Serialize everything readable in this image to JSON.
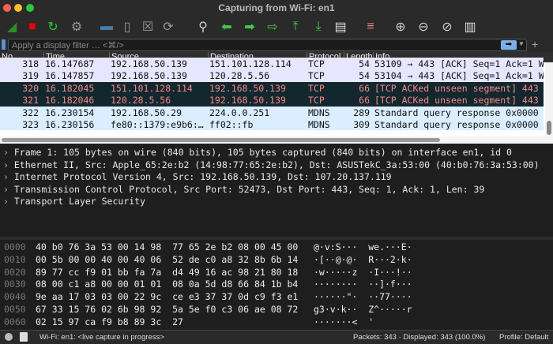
{
  "window": {
    "title": "Capturing from Wi-Fi: en1"
  },
  "toolbar": [
    "shark-fin-start-icon",
    "stop-icon",
    "restart-icon",
    "options-gear-icon",
    "open-folder-icon",
    "save-file-icon",
    "close-file-icon",
    "reload-file-icon",
    "find-icon",
    "go-back-icon",
    "go-forward-icon",
    "go-to-packet-icon",
    "first-packet-icon",
    "last-packet-icon",
    "autoscroll-icon",
    "colorize-icon",
    "zoom-in-icon",
    "zoom-out-icon",
    "zoom-reset-icon",
    "resize-columns-icon"
  ],
  "filter": {
    "placeholder": "Apply a display filter … <⌘/>"
  },
  "packet_list": {
    "columns": [
      "No.",
      "Time",
      "Source",
      "Destination",
      "Protocol",
      "Length",
      "Info"
    ],
    "rows": [
      {
        "no": "318",
        "time": "16.147687",
        "src": "192.168.50.139",
        "dst": "151.101.128.114",
        "proto": "TCP",
        "len": "54",
        "info": "53109 → 443 [ACK] Seq=1 Ack=1 W",
        "style": "tcp"
      },
      {
        "no": "319",
        "time": "16.147857",
        "src": "192.168.50.139",
        "dst": "120.28.5.56",
        "proto": "TCP",
        "len": "54",
        "info": "53104 → 443 [ACK] Seq=1 Ack=1 W",
        "style": "tcp"
      },
      {
        "no": "320",
        "time": "16.182045",
        "src": "151.101.128.114",
        "dst": "192.168.50.139",
        "proto": "TCP",
        "len": "66",
        "info": "[TCP ACKed unseen segment] 443",
        "style": "bad"
      },
      {
        "no": "321",
        "time": "16.182046",
        "src": "120.28.5.56",
        "dst": "192.168.50.139",
        "proto": "TCP",
        "len": "66",
        "info": "[TCP ACKed unseen segment] 443",
        "style": "bad"
      },
      {
        "no": "322",
        "time": "16.230154",
        "src": "192.168.50.29",
        "dst": "224.0.0.251",
        "proto": "MDNS",
        "len": "289",
        "info": "Standard query response 0x0000",
        "style": "mdns"
      },
      {
        "no": "323",
        "time": "16.230156",
        "src": "fe80::1379:e9b6:…",
        "dst": "ff02::fb",
        "proto": "MDNS",
        "len": "309",
        "info": "Standard query response 0x0000",
        "style": "mdns"
      }
    ]
  },
  "colors": {
    "tcp": "#e7e6ff",
    "bad": "#12272e",
    "bad_text": "#f78787",
    "mdns": "#daeeff"
  },
  "details": [
    "Frame 1: 105 bytes on wire (840 bits), 105 bytes captured (840 bits) on interface en1, id 0",
    "Ethernet II, Src: Apple_65:2e:b2 (14:98:77:65:2e:b2), Dst: ASUSTekC_3a:53:00 (40:b0:76:3a:53:00)",
    "Internet Protocol Version 4, Src: 192.168.50.139, Dst: 107.20.137.119",
    "Transmission Control Protocol, Src Port: 52473, Dst Port: 443, Seq: 1, Ack: 1, Len: 39",
    "Transport Layer Security"
  ],
  "hex": [
    {
      "off": "0000",
      "hex": "40 b0 76 3a 53 00 14 98  77 65 2e b2 08 00 45 00",
      "ascii": "@·v:S···  we.···E·"
    },
    {
      "off": "0010",
      "hex": "00 5b 00 00 40 00 40 06  52 de c0 a8 32 8b 6b 14",
      "ascii": "·[··@·@·  R···2·k·"
    },
    {
      "off": "0020",
      "hex": "89 77 cc f9 01 bb fa 7a  d4 49 16 ac 98 21 80 18",
      "ascii": "·w·····z  ·I···!··"
    },
    {
      "off": "0030",
      "hex": "08 00 c1 a8 00 00 01 01  08 0a 5d d8 66 84 1b b4",
      "ascii": "········  ··]·f···"
    },
    {
      "off": "0040",
      "hex": "9e aa 17 03 03 00 22 9c  ce e3 37 37 0d c9 f3 e1",
      "ascii": "······\"·  ··77····"
    },
    {
      "off": "0050",
      "hex": "67 33 15 76 02 6b 98 92  5a 5e f0 c3 06 ae 08 72",
      "ascii": "g3·v·k··  Z^·····r"
    },
    {
      "off": "0060",
      "hex": "02 15 97 ca f9 b8 89 3c  27",
      "ascii": "·······<  '"
    }
  ],
  "status": {
    "interface": "Wi-Fi: en1: <live capture in progress>",
    "packets": "Packets: 343 · Displayed: 343 (100.0%)",
    "profile": "Profile: Default"
  }
}
